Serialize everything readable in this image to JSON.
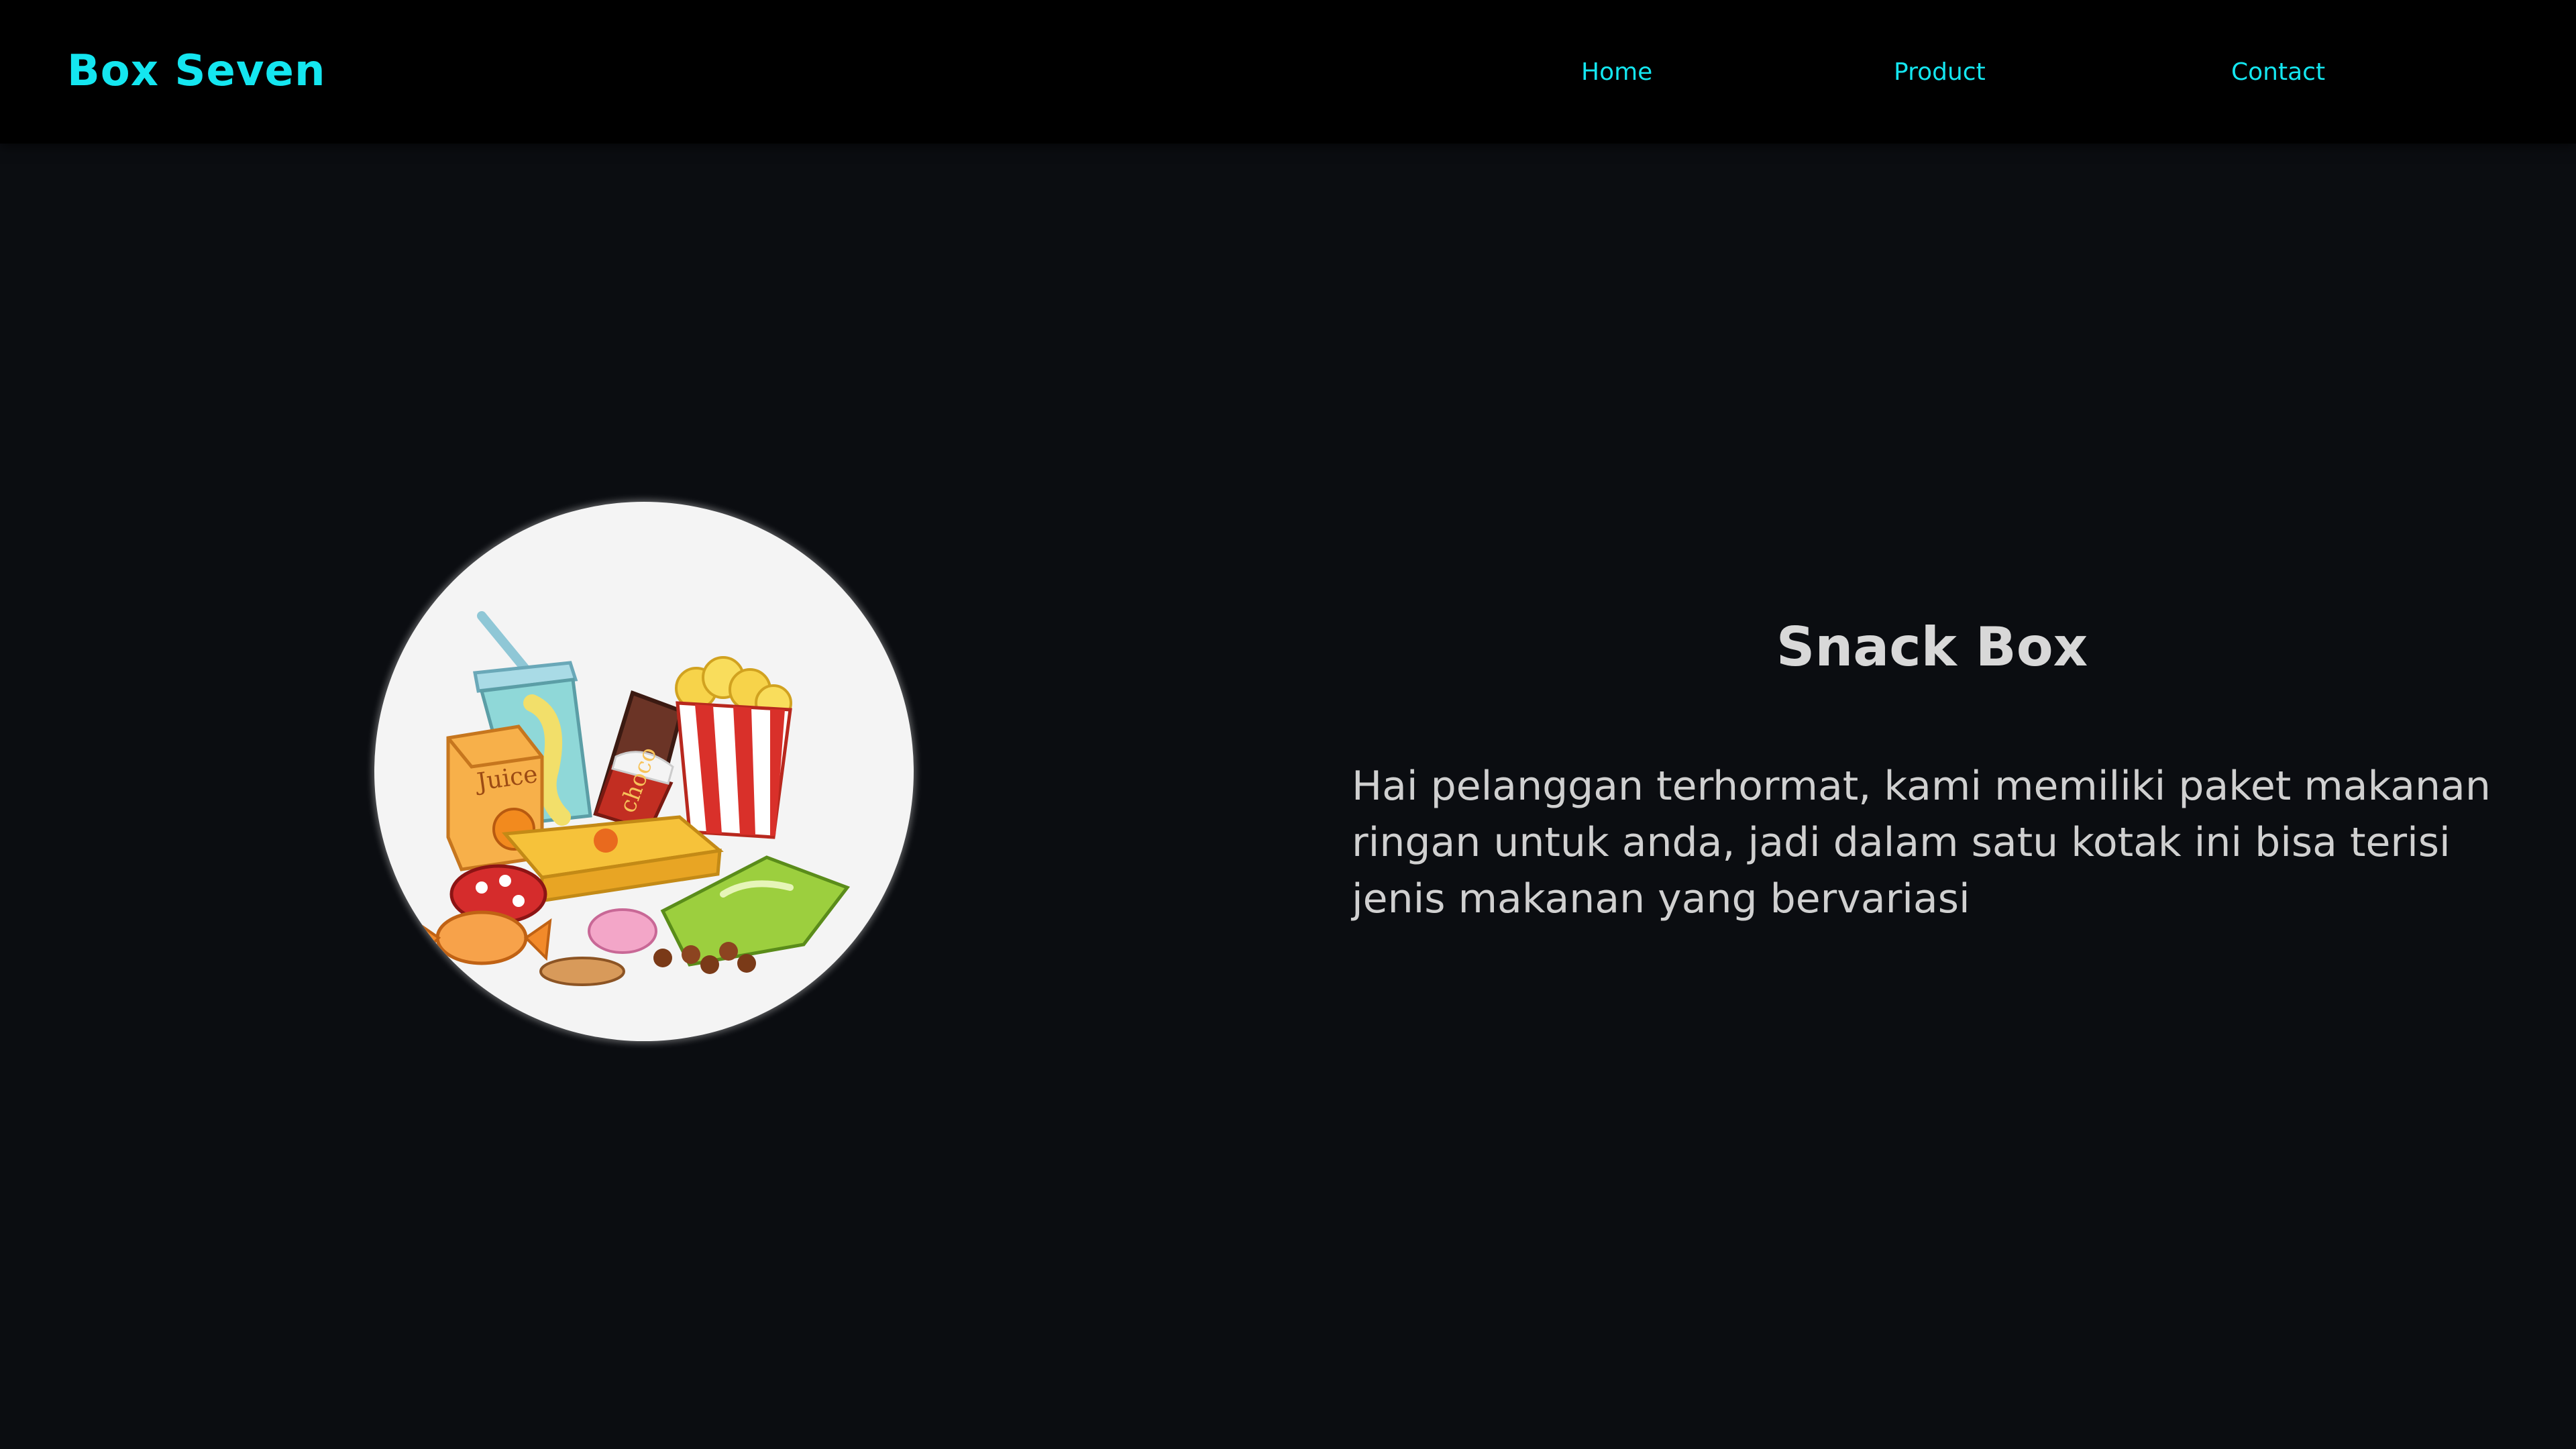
{
  "header": {
    "brand": "Box Seven",
    "nav": [
      {
        "label": "Home"
      },
      {
        "label": "Product"
      },
      {
        "label": "Contact"
      }
    ]
  },
  "hero": {
    "image_icon": "snack-assortment-illustration",
    "image_labels": {
      "juice": "Juice",
      "choco": "choco"
    },
    "title": "Snack Box",
    "description": "Hai pelanggan terhormat, kami memiliki paket makanan ringan untuk anda, jadi dalam satu kotak ini bisa terisi jenis makanan yang bervariasi"
  },
  "colors": {
    "page_background": "#0b0d11",
    "navbar_background": "#000000",
    "accent": "#14e6f0",
    "title_text": "#d8d8d8",
    "body_text": "#d0d0d0",
    "image_circle": "#f4f4f4"
  }
}
